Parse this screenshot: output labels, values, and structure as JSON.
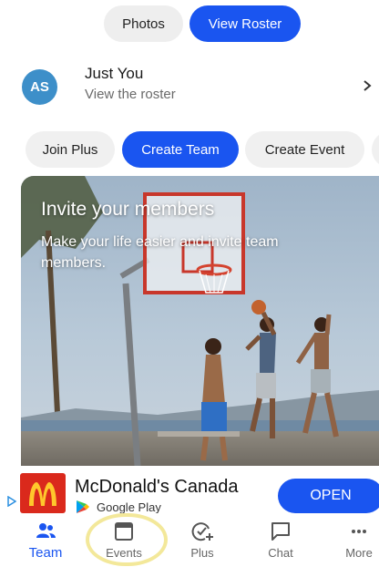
{
  "segments": {
    "photos_label": "Photos",
    "roster_label": "View Roster"
  },
  "roster": {
    "avatar_initials": "AS",
    "name": "Just You",
    "subtitle": "View the roster"
  },
  "chips": {
    "join_plus": "Join Plus",
    "create_team": "Create Team",
    "create_event": "Create Event"
  },
  "promo": {
    "title": "Invite your members",
    "text": "Make your life easier and invite team members."
  },
  "ad": {
    "name": "McDonald's Canada",
    "store": "Google Play",
    "cta": "OPEN"
  },
  "nav": {
    "items": [
      {
        "label": "Team",
        "icon": "team-icon",
        "active": true
      },
      {
        "label": "Events",
        "icon": "calendar-icon",
        "active": false
      },
      {
        "label": "Plus",
        "icon": "plus-icon",
        "active": false
      },
      {
        "label": "Chat",
        "icon": "chat-icon",
        "active": false
      },
      {
        "label": "More",
        "icon": "more-icon",
        "active": false
      }
    ]
  },
  "colors": {
    "accent": "#1a55f0",
    "avatar": "#3d8fc9",
    "ad_brand": "#da291c"
  }
}
